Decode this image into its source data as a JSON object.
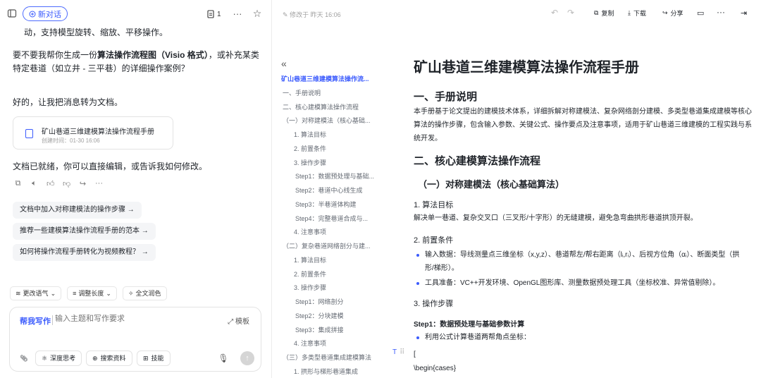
{
  "left": {
    "new_chat": "新对话",
    "page_count": "1",
    "msg0": "动，支持模型旋转、缩放、平移操作。",
    "msg1_a": "要不要我帮你生成一份",
    "msg1_b": "算法操作流程图（Visio 格式）",
    "msg1_c": "，或补充某类特定巷道（如立井 - 三平巷）的详细操作案例？",
    "msg2": "好的，让我把消息转为文档。",
    "card_title": "矿山巷道三维建模算法操作流程手册",
    "card_sub": "创建时间：01-30 16:06",
    "msg3": "文档已就绪，你可以直接编辑，或告诉我如何修改。",
    "suggestions": [
      "文档中加入对称建模法的操作步骤 →",
      "推荐一些建模算法操作流程手册的范本 →",
      "如何将操作流程手册转化为视频教程？ →"
    ],
    "tools": [
      "更改语气",
      "调整长度",
      "全文润色"
    ],
    "composer": {
      "mode": "帮我写作",
      "placeholder": "输入主题和写作要求",
      "template": "模板",
      "deep": "深度思考",
      "search": "搜索资料",
      "skill": "技能"
    }
  },
  "right": {
    "saved": "修改于 昨天 16:06",
    "copy": "复制",
    "download": "下载",
    "share": "分享",
    "toc": [
      {
        "t": "矿山巷道三维建模算法操作流...",
        "lv": 0
      },
      {
        "t": "一、手册说明",
        "lv": 1
      },
      {
        "t": "二、核心建模算法操作流程",
        "lv": 1
      },
      {
        "t": "（一）对称建模法（核心基础...",
        "lv": 2
      },
      {
        "t": "1. 算法目标",
        "lv": 3
      },
      {
        "t": "2. 前置条件",
        "lv": 3
      },
      {
        "t": "3. 操作步骤",
        "lv": 3
      },
      {
        "t": "Step1：数据预处理与基础...",
        "lv": 4
      },
      {
        "t": "Step2：巷道中心线生成",
        "lv": 4
      },
      {
        "t": "Step3：半巷道体构建",
        "lv": 4
      },
      {
        "t": "Step4：完整巷道合成与...",
        "lv": 4
      },
      {
        "t": "4. 注意事项",
        "lv": 3
      },
      {
        "t": "（二）复杂巷道网络剖分与建...",
        "lv": 2
      },
      {
        "t": "1. 算法目标",
        "lv": 3
      },
      {
        "t": "2. 前置条件",
        "lv": 3
      },
      {
        "t": "3. 操作步骤",
        "lv": 3
      },
      {
        "t": "Step1：网络剖分",
        "lv": 4
      },
      {
        "t": "Step2：分块建模",
        "lv": 4
      },
      {
        "t": "Step3：集成拼接",
        "lv": 4
      },
      {
        "t": "4. 注意事项",
        "lv": 3
      },
      {
        "t": "（三）多类型巷道集成建模算法",
        "lv": 2
      },
      {
        "t": "1. 拱形与梯形巷道集成",
        "lv": 3
      }
    ],
    "doc": {
      "title": "矿山巷道三维建模算法操作流程手册",
      "s1": "一、手册说明",
      "p1": "本手册基于论文提出的建模技术体系，详细拆解对称建模法、复杂网络剖分建模、多类型巷道集成建模等核心算法的操作步骤，包含输入参数、关键公式、操作要点及注意事项，适用于矿山巷道三维建模的工程实践与系统开发。",
      "s2": "二、核心建模算法操作流程",
      "s2a": "（一）对称建模法（核心基础算法）",
      "h_goal": "1. 算法目标",
      "p_goal": "解决单一巷道、复杂交叉口（三叉形/十字形）的无缝建模，避免急弯曲拱形巷道拱顶开裂。",
      "h_pre": "2. 前置条件",
      "li1": "输入数据：导线测量点三维坐标（x,y,z）、巷道帮左/帮右距离（lᵢ,rᵢ）、后视方位角（αᵢ）、断面类型（拱形/梯形）。",
      "li2": "工具准备：VC++开发环境、OpenGL图形库、测量数据预处理工具（坐标校准、异常值剔除）。",
      "h_steps": "3. 操作步骤",
      "step1": "Step1：数据预处理与基础参数计算",
      "li3": "利用公式计算巷道两帮角点坐标：",
      "bracket": "[",
      "cases": "\\begin{cases}"
    }
  }
}
